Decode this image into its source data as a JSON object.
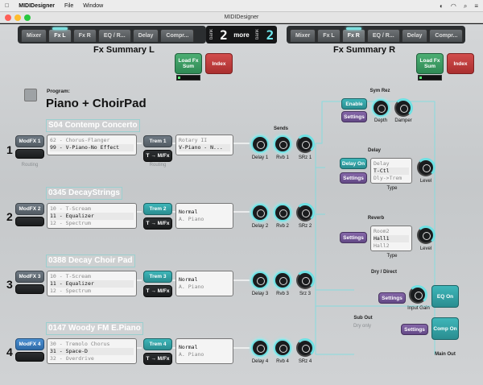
{
  "menubar": {
    "app": "MIDIDesigner",
    "items": [
      "File",
      "Window"
    ]
  },
  "window": {
    "title": "MIDIDesigner"
  },
  "tabs_left": [
    "Mixer",
    "Fx L",
    "Fx R",
    "EQ / R...",
    "Delay",
    "Compr..."
  ],
  "tabs_right": [
    "Mixer",
    "Fx L",
    "Fx R",
    "EQ / R...",
    "Delay",
    "Compr..."
  ],
  "bank": {
    "label": "bank",
    "left_num": "2",
    "more": "more",
    "right_num": "2"
  },
  "summary_left": {
    "title": "Fx Summary L",
    "load": "Load Fx Sum",
    "index": "Index"
  },
  "summary_right": {
    "title": "Fx Summary R",
    "load": "Load Fx Sum",
    "index": "Index"
  },
  "program": {
    "label": "Program:",
    "name": "Piano + ChoirPad"
  },
  "sends_label": "Sends",
  "routing_label": "Routing",
  "rows": [
    {
      "num": "1",
      "patch": "S04 Contemp Concerto",
      "modfx": "ModFX 1",
      "list": [
        "62 - Chorus-Flanger",
        "99 - V-Piano-No Effect"
      ],
      "sel": 1,
      "trem": "Trem 1",
      "tmfx": "T → M/Fx",
      "dest": [
        "Rotary II",
        "V-Piano - N..."
      ],
      "dest_sel": 1,
      "knobs": [
        "Delay 1",
        "Rvb 1",
        "SRz 1"
      ]
    },
    {
      "num": "2",
      "patch": "0345 DecayStrings",
      "modfx": "ModFX 2",
      "list": [
        "10 - T-Scream",
        "11 - Equalizer",
        "12 - Spectrum"
      ],
      "sel": 1,
      "trem": "Trem 2",
      "tmfx": "T → M/Fx",
      "dest": [
        "Normal",
        "A. Piano"
      ],
      "dest_sel": 0,
      "knobs": [
        "Delay 2",
        "Rvb 2",
        "SRz 2"
      ]
    },
    {
      "num": "3",
      "patch": "0388 Decay Choir Pad",
      "modfx": "ModFX 3",
      "list": [
        "10 - T-Scream",
        "11 - Equalizer",
        "12 - Spectrum"
      ],
      "sel": 1,
      "trem": "Trem 3",
      "tmfx": "T → M/Fx",
      "dest": [
        "Normal",
        "A. Piano"
      ],
      "dest_sel": 0,
      "knobs": [
        "Delay 3",
        "Rvb 3",
        "Srz 3"
      ]
    },
    {
      "num": "4",
      "patch": "0147 Woody FM E.Piano",
      "modfx": "ModFX 4",
      "list": [
        "30 - Tremolo Chorus",
        "31 - Space-D",
        "32 - Overdrive"
      ],
      "sel": 1,
      "trem": "Trem 4",
      "tmfx": "T → M/Fx",
      "dest": [
        "Normal",
        "A. Piano"
      ],
      "dest_sel": 0,
      "knobs": [
        "Delay 4",
        "Rvb 4",
        "SRz 4"
      ]
    }
  ],
  "sym_rez": {
    "title": "Sym Rez",
    "enable": "Enable",
    "settings": "Settings",
    "depth": "Depth",
    "damper": "Damper"
  },
  "delay": {
    "title": "Delay",
    "on": "Delay On",
    "settings": "Settings",
    "list": [
      "Delay",
      "T-Ctl",
      "Dly->Trem"
    ],
    "type": "Type",
    "level": "Level"
  },
  "reverb": {
    "title": "Reverb",
    "settings": "Settings",
    "list": [
      "Room2",
      "Hall1",
      "Hall2"
    ],
    "type": "Type",
    "level": "Level"
  },
  "dry_direct": "Dry / Direct",
  "eq": {
    "settings": "Settings",
    "on": "EQ On",
    "input_gain": "Input Gain"
  },
  "comp": {
    "settings": "Settings",
    "on": "Comp On"
  },
  "sub_out": "Sub Out",
  "dry_only": "Dry only",
  "main_out": "Main Out",
  "colors": {
    "accent": "#6fe0e3",
    "teal": "#3eb6b9",
    "purple": "#8567a8",
    "green": "#4cae73",
    "red": "#d24d4d"
  }
}
